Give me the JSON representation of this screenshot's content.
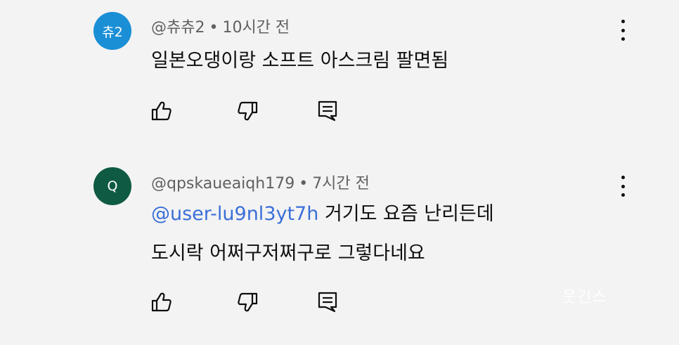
{
  "comments": [
    {
      "avatar_text": "츄2",
      "avatar_color": "#1a8fd6",
      "handle": "@츄츄2",
      "separator": "•",
      "time": "10시간 전",
      "lines": [
        "일본오댕이랑 소프트 아스크림 팔면됨"
      ]
    },
    {
      "avatar_text": "Q",
      "avatar_color": "#0f5a43",
      "handle": "@qpskaueaiqh179",
      "separator": "•",
      "time": "7시간 전",
      "mention": "@user-lu9nl3yt7h",
      "line1_rest": " 거기도 요즘 난리든데",
      "line2": "도시락 어쩌구저쩌구로 그렇다네요"
    }
  ],
  "icons": {
    "like": "thumbs-up-icon",
    "dislike": "thumbs-down-icon",
    "reply": "reply-icon",
    "more": "more-vert-icon"
  },
  "watermark": "웃긴스"
}
